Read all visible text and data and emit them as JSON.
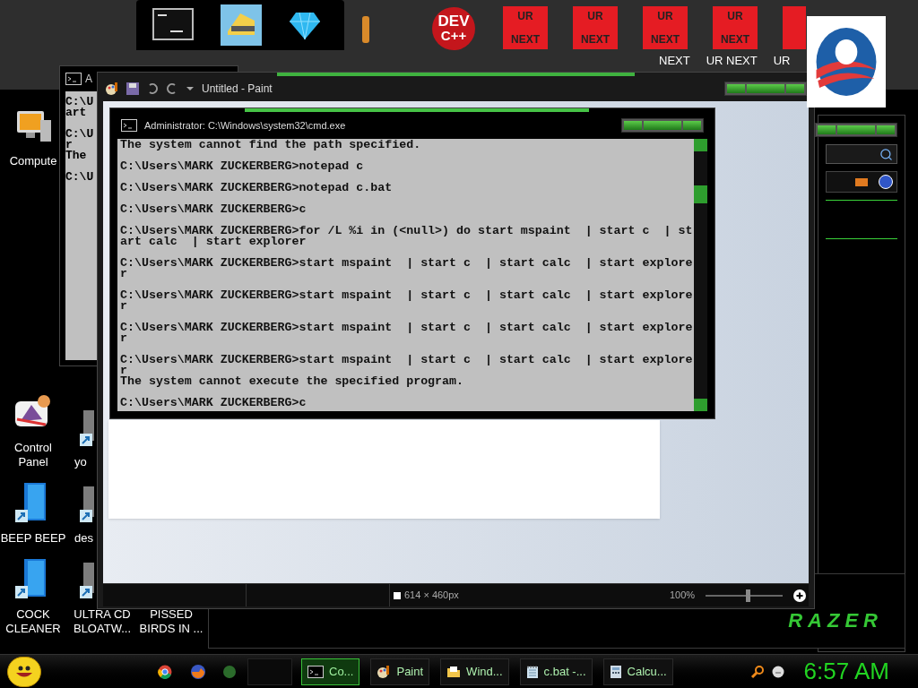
{
  "dock": {
    "dev_icon": {
      "line1": "DEV",
      "line2": "C++"
    },
    "tiles": [
      {
        "top": "UR",
        "bottom": "NEXT"
      },
      {
        "top": "UR",
        "bottom": "NEXT"
      },
      {
        "top": "UR",
        "bottom": "NEXT"
      },
      {
        "top": "UR",
        "bottom": "NEXT"
      }
    ],
    "tile_labels": [
      "NEXT",
      "UR NEXT",
      "UR"
    ]
  },
  "computer_icon": {
    "label": "Compute"
  },
  "desktop_columns": [
    [
      {
        "label": "Control Panel",
        "kind": "panel"
      },
      {
        "label": "BEEP BEEP",
        "kind": "file"
      },
      {
        "label": "COCK CLEANER",
        "kind": "file"
      }
    ],
    [
      {
        "label": "yo",
        "kind": "shortcut"
      },
      {
        "label": "des",
        "kind": "shortcut"
      },
      {
        "label": "ULTRA CD BLOATW...",
        "kind": "shortcut"
      }
    ],
    [
      {
        "label": "PISSED BIRDS IN ..."
      }
    ]
  ],
  "back_console": {
    "title": "A",
    "lines": [
      "C:\\U",
      "art",
      "C:\\U",
      "r",
      "The",
      "C:\\U"
    ]
  },
  "paint": {
    "title": "Untitled - Paint",
    "status": {
      "size": "614 × 460px",
      "zoom": "100%",
      "zoom_slider": {
        "level": 0.55
      }
    }
  },
  "console": {
    "title": "Administrator: C:\\Windows\\system32\\cmd.exe",
    "blocks": [
      [
        "The system cannot find the path specified."
      ],
      [
        "C:\\Users\\MARK ZUCKERBERG>notepad c"
      ],
      [
        "C:\\Users\\MARK ZUCKERBERG>notepad c.bat"
      ],
      [
        "C:\\Users\\MARK ZUCKERBERG>c"
      ],
      [
        "C:\\Users\\MARK ZUCKERBERG>for /L %i in (<null>) do start mspaint  | start c  | st",
        "art calc  | start explorer"
      ],
      [
        "C:\\Users\\MARK ZUCKERBERG>start mspaint  | start c  | start calc  | start explore",
        "r"
      ],
      [
        "C:\\Users\\MARK ZUCKERBERG>start mspaint  | start c  | start calc  | start explore",
        "r"
      ],
      [
        "C:\\Users\\MARK ZUCKERBERG>start mspaint  | start c  | start calc  | start explore",
        "r"
      ],
      [
        "C:\\Users\\MARK ZUCKERBERG>start mspaint  | start c  | start calc  | start explore",
        "r",
        "The system cannot execute the specified program."
      ],
      [
        "C:\\Users\\MARK ZUCKERBERG>c"
      ]
    ]
  },
  "razer_logo": "RAZER",
  "taskbar": {
    "tasks": [
      {
        "label": "Co...",
        "selected": true,
        "kind": "console"
      },
      {
        "label": "Paint",
        "selected": false,
        "kind": "paint"
      },
      {
        "label": "Wind...",
        "selected": false,
        "kind": "folder"
      },
      {
        "label": "c.bat -...",
        "selected": false,
        "kind": "notepad"
      },
      {
        "label": "Calcu...",
        "selected": false,
        "kind": "calculator"
      }
    ],
    "clock": "6:57 AM"
  }
}
